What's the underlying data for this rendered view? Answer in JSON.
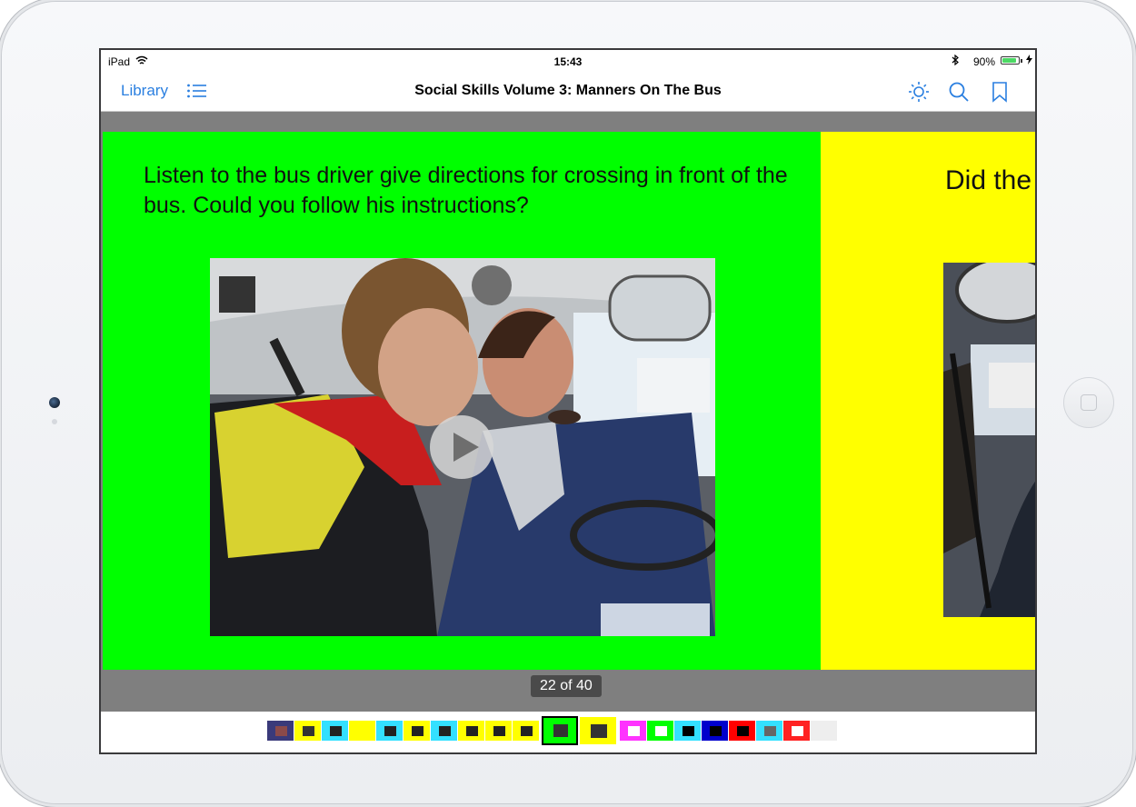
{
  "status_bar": {
    "device": "iPad",
    "time": "15:43",
    "battery_percent": "90%",
    "battery_level": 0.9,
    "bluetooth_icon": "bluetooth-icon",
    "wifi_icon": "wifi-icon"
  },
  "nav": {
    "library_label": "Library",
    "title": "Social Skills Volume 3: Manners On The Bus",
    "icons": [
      "list-icon",
      "brightness-icon",
      "search-icon",
      "bookmark-icon"
    ],
    "accent_color": "#2a7fe0"
  },
  "slide": {
    "text": "Listen to the bus driver give directions for crossing in front of the bus. Could you follow his instructions?",
    "background": "#00ff00"
  },
  "next_slide": {
    "text": "Did the",
    "background": "#ffff00"
  },
  "page_indicator": "22 of 40",
  "thumbnails": [
    {
      "bg": "#3a3a7a",
      "inner": "#8b4a4a"
    },
    {
      "bg": "#ffff00",
      "inner": "#333333"
    },
    {
      "bg": "#33e0ff",
      "inner": "#222222"
    },
    {
      "bg": "#ffff00",
      "inner": "#ffff00"
    },
    {
      "bg": "#33e0ff",
      "inner": "#222222"
    },
    {
      "bg": "#ffff00",
      "inner": "#222222"
    },
    {
      "bg": "#33e0ff",
      "inner": "#222222"
    },
    {
      "bg": "#ffff00",
      "inner": "#222222"
    },
    {
      "bg": "#ffff00",
      "inner": "#222222"
    },
    {
      "bg": "#ffff00",
      "inner": "#222222"
    },
    {
      "bg": "#00ff00",
      "inner": "#333333",
      "current": true
    },
    {
      "bg": "#ffff00",
      "inner": "#333333",
      "next": true
    },
    {
      "bg": "#ff33ff",
      "inner": "#ffffff"
    },
    {
      "bg": "#00ff00",
      "inner": "#ffffff"
    },
    {
      "bg": "#33e0ff",
      "inner": "#000000"
    },
    {
      "bg": "#0000cc",
      "inner": "#000000"
    },
    {
      "bg": "#ff0000",
      "inner": "#000000"
    },
    {
      "bg": "#33e0ff",
      "inner": "#666666"
    },
    {
      "bg": "#ff2222",
      "inner": "#ffffff"
    },
    {
      "bg": "#eeeeee",
      "inner": "#eeeeee"
    }
  ]
}
